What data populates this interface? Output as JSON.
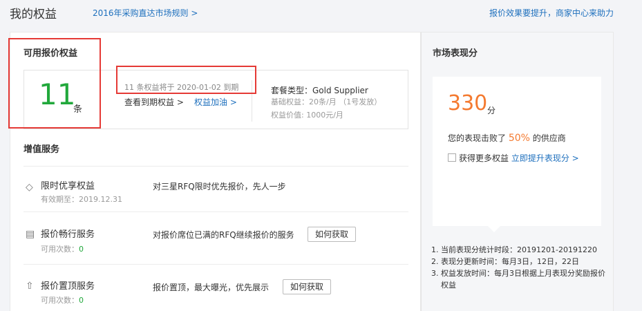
{
  "header": {
    "title": "我的权益",
    "rules_link": "2016年采购直达市场规则 >",
    "help_link": "报价效果要提升，商家中心来助力"
  },
  "quota": {
    "section_title": "可用报价权益",
    "count": "11",
    "unit": "条",
    "expire_note": "11 条权益将于 2020-01-02 到期",
    "view_expire": "查看到期权益 >",
    "add_quota": "权益加油 >",
    "package_type": "套餐类型：Gold Supplier",
    "base_quota": "基础权益：20条/月 （1号发放）",
    "quota_value": "权益价值: 1000元/月"
  },
  "services": {
    "section_title": "增值服务",
    "items": [
      {
        "icon": "diamond-icon",
        "glyph": "◇",
        "name": "限时优享权益",
        "sub_label": "有效期至：2019.12.31",
        "sub_value": "",
        "desc": "对三星RFQ限时优先报价，先人一步",
        "button": ""
      },
      {
        "icon": "document-icon",
        "glyph": "▤",
        "name": "报价畅行服务",
        "sub_label": "可用次数：",
        "sub_value": "0",
        "desc": "对报价席位已满的RFQ继续报价的服务",
        "button": "如何获取"
      },
      {
        "icon": "pin-top-icon",
        "glyph": "⇧",
        "name": "报价置顶服务",
        "sub_label": "可用次数：",
        "sub_value": "0",
        "desc": "报价置顶，最大曝光，优先展示",
        "button": "如何获取"
      }
    ]
  },
  "market": {
    "title": "市场表现分",
    "score": "330",
    "score_unit": "分",
    "beat_prefix": "您的表现击败了",
    "beat_pct": "50%",
    "beat_suffix": "的供应商",
    "more_text": "获得更多权益",
    "more_link": "立即提升表现分 >",
    "notes": [
      {
        "idx": "1.",
        "text": "当前表现分统计时段：20191201-20191220"
      },
      {
        "idx": "2.",
        "text": "表现分更新时间：每月3日，12日，22日"
      },
      {
        "idx": "3.",
        "text": "权益发放时间：每月3日根据上月表现分奖励报价权益"
      }
    ]
  },
  "colors": {
    "accent_green": "#21a83b",
    "accent_orange": "#f47a30",
    "link_blue": "#1d6fbd",
    "highlight_red": "#e53935"
  }
}
